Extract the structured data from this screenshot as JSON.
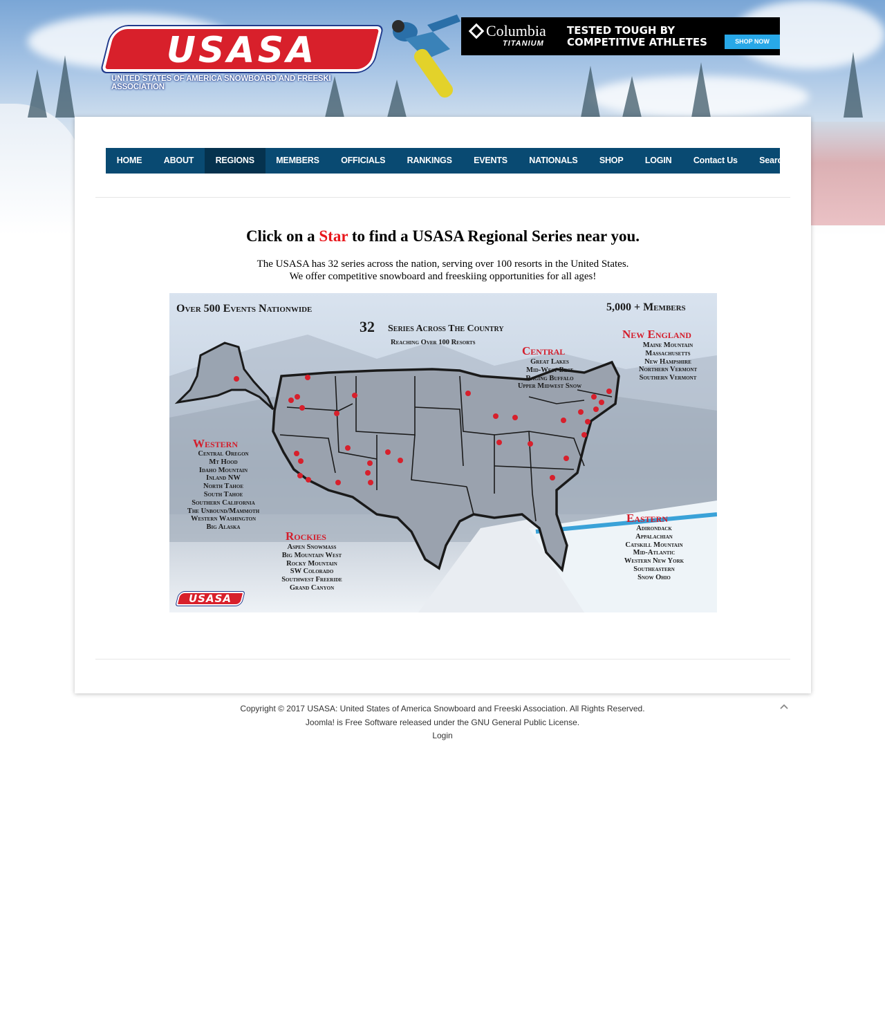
{
  "header": {
    "logo": {
      "word": "USASA",
      "tagline": "UNITED STATES OF AMERICA SNOWBOARD AND FREESKI ASSOCIATION"
    },
    "ad": {
      "brand": "Columbia",
      "brand_sub": "TITANIUM",
      "tagline": "TESTED TOUGH BY COMPETITIVE ATHLETES",
      "cta": "SHOP NOW"
    }
  },
  "nav": {
    "items": [
      "HOME",
      "ABOUT",
      "REGIONS",
      "MEMBERS",
      "OFFICIALS",
      "RANKINGS",
      "EVENTS",
      "NATIONALS",
      "SHOP",
      "LOGIN",
      "Contact Us",
      "Search"
    ],
    "active": "REGIONS"
  },
  "main": {
    "headline_pre": "Click on a ",
    "headline_star": "Star",
    "headline_post": " to find a USASA Regional Series near you.",
    "intro_line1": "The USASA has 32 series across the nation, serving over 100 resorts in the United States.",
    "intro_line2": "We offer competitive snowboard and freeskiing opportunities for all ages!"
  },
  "map": {
    "events": "Over 500 Events Nationwide",
    "members": "5,000 + Members",
    "series_num": "32",
    "series_text": "Series Across The Country",
    "series_sub": "Reaching Over 100 Resorts",
    "regions": {
      "central": {
        "title": "Central",
        "items": [
          "Great Lakes",
          "Mid-West Best",
          "Raging Buffalo",
          "Upper Midwest Snow"
        ]
      },
      "new_england": {
        "title": "New England",
        "items": [
          "Maine Mountain",
          "Massachusetts",
          "New Hampshire",
          "Northern Vermont",
          "Southern Vermont"
        ]
      },
      "western": {
        "title": "Western",
        "items": [
          "Central Oregon",
          "Mt Hood",
          "Idaho Mountain",
          "Inland NW",
          "North Tahoe",
          "South Tahoe",
          "Southern California",
          "The Unbound/Mammoth",
          "Western Washington",
          "Big Alaska"
        ]
      },
      "rockies": {
        "title": "Rockies",
        "items": [
          "Aspen Snowmass",
          "Big Mountain West",
          "Rocky Mountain",
          "SW Colorado",
          "Southwest Freeride",
          "Grand Canyon"
        ]
      },
      "eastern": {
        "title": "Eastern",
        "items": [
          "Adirondack",
          "Appalachian",
          "Catskill Mountain",
          "Mid-Atlantic",
          "Western New York",
          "Southeastern",
          "Snow Ohio"
        ]
      }
    },
    "mini_logo": "USASA",
    "colors": {
      "star": "#d7202c",
      "outline": "#1a1a1a"
    }
  },
  "footer": {
    "copyright": "Copyright © 2017 USASA: United States of America Snowboard and Freeski Association. All Rights Reserved.",
    "joomla_pre": "Joomla! is Free Software released under the ",
    "joomla_link": "GNU General Public License.",
    "login": "Login"
  },
  "colors": {
    "nav_bg": "#094a72",
    "nav_active": "#05324e",
    "logo_red": "#d8202b",
    "logo_blue": "#203a8c",
    "headline_star": "#e8161b",
    "ad_cta": "#28a8e8"
  }
}
